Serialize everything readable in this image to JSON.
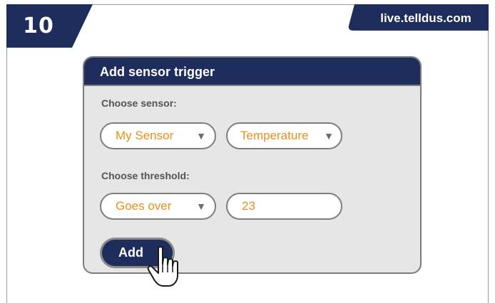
{
  "step": {
    "number": "10",
    "color": "#1e2d5b"
  },
  "url_tab": {
    "text": "live.telldus.com",
    "color": "#1e2d5b"
  },
  "dialog": {
    "title": "Add sensor trigger",
    "sensor_section": {
      "label": "Choose sensor:",
      "sensor_dropdown": "My Sensor",
      "type_dropdown": "Temperature"
    },
    "threshold_section": {
      "label": "Choose threshold:",
      "condition_dropdown": "Goes over",
      "value": "23"
    },
    "add_button": "Add"
  },
  "icons": {
    "dropdown_caret": "chevron-down-icon",
    "cursor": "hand-pointer-icon"
  },
  "colors": {
    "accent_text": "#e8901a",
    "header": "#1e2d5b",
    "panel": "#e6e6e6",
    "border": "#7d7d7d"
  }
}
